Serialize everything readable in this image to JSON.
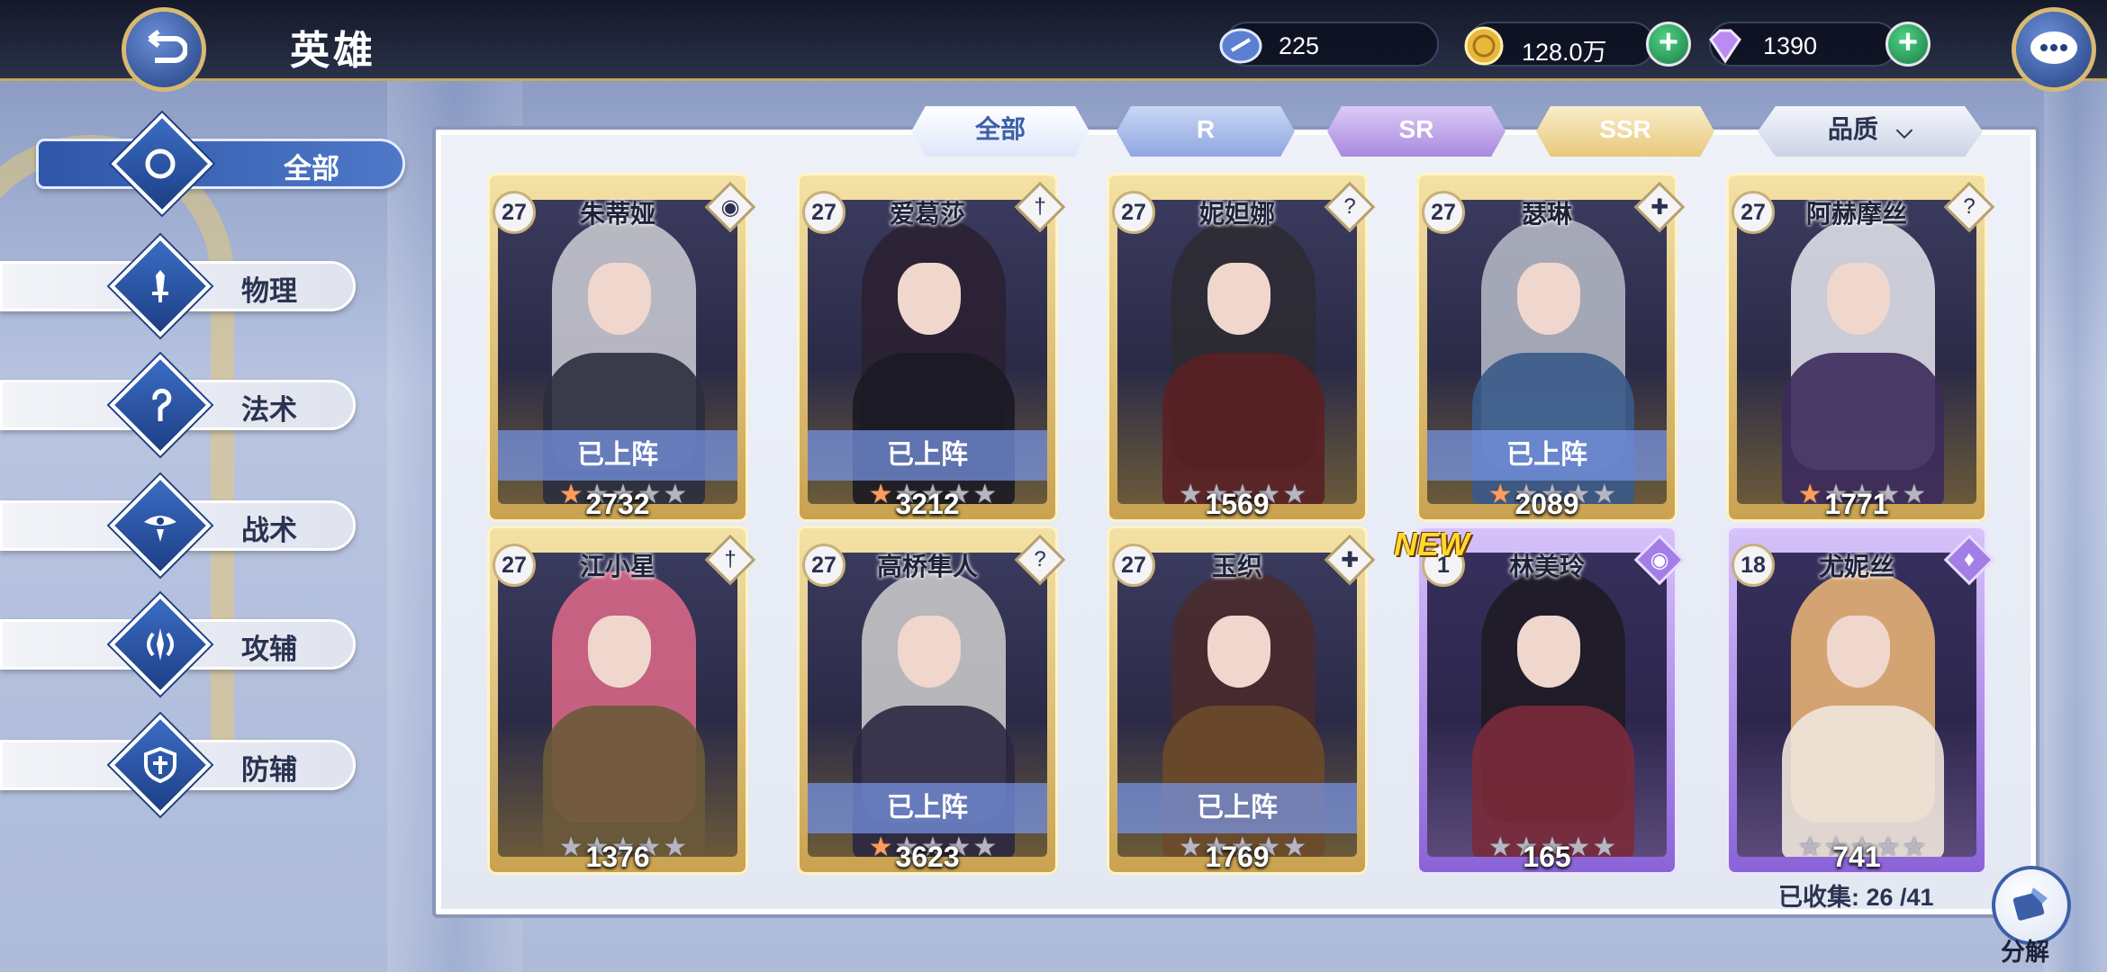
{
  "header": {
    "title": "英雄",
    "stamina": "225",
    "gold": "128.0万",
    "gems": "1390"
  },
  "sidebar": {
    "items": [
      {
        "label": "全部",
        "icon": "ring-icon",
        "active": true
      },
      {
        "label": "物理",
        "icon": "sword-icon",
        "active": false
      },
      {
        "label": "法术",
        "icon": "staff-icon",
        "active": false
      },
      {
        "label": "战术",
        "icon": "eye-icon",
        "active": false
      },
      {
        "label": "攻辅",
        "icon": "wing-blade-icon",
        "active": false
      },
      {
        "label": "防辅",
        "icon": "shield-icon",
        "active": false
      }
    ]
  },
  "tabs": {
    "all": "全部",
    "r": "R",
    "sr": "SR",
    "ssr": "SSR",
    "quality": "品质"
  },
  "heroes": [
    {
      "level": "27",
      "name": "朱蒂娅",
      "power": "2732",
      "deployed": "已上阵",
      "stars": 1,
      "rarity": "gold",
      "class_icon": "eye-icon"
    },
    {
      "level": "27",
      "name": "爱葛莎",
      "power": "3212",
      "deployed": "已上阵",
      "stars": 1,
      "rarity": "gold",
      "class_icon": "sword-icon"
    },
    {
      "level": "27",
      "name": "妮妲娜",
      "power": "1569",
      "deployed": "",
      "stars": 0,
      "rarity": "gold",
      "class_icon": "staff-icon"
    },
    {
      "level": "27",
      "name": "瑟琳",
      "power": "2089",
      "deployed": "已上阵",
      "stars": 1,
      "rarity": "gold",
      "class_icon": "shield-icon"
    },
    {
      "level": "27",
      "name": "阿赫摩丝",
      "power": "1771",
      "deployed": "",
      "stars": 1,
      "rarity": "gold",
      "class_icon": "staff-icon"
    },
    {
      "level": "27",
      "name": "江小星",
      "power": "1376",
      "deployed": "",
      "stars": 0,
      "rarity": "gold",
      "class_icon": "sword-icon"
    },
    {
      "level": "27",
      "name": "高桥隼人",
      "power": "3623",
      "deployed": "已上阵",
      "stars": 1,
      "rarity": "gold",
      "class_icon": "staff-icon"
    },
    {
      "level": "27",
      "name": "玉织",
      "power": "1769",
      "deployed": "已上阵",
      "stars": 0,
      "rarity": "gold",
      "class_icon": "shield-icon"
    },
    {
      "level": "1",
      "name": "林美玲",
      "power": "165",
      "deployed": "",
      "stars": 0,
      "rarity": "purple",
      "class_icon": "eye-icon"
    },
    {
      "level": "18",
      "name": "尤妮丝",
      "power": "741",
      "deployed": "",
      "stars": 0,
      "rarity": "purple",
      "class_icon": "wing-blade-icon"
    }
  ],
  "new_badge": "NEW",
  "footer": {
    "collected": "已收集: 26 /41",
    "decompose": "分解"
  }
}
